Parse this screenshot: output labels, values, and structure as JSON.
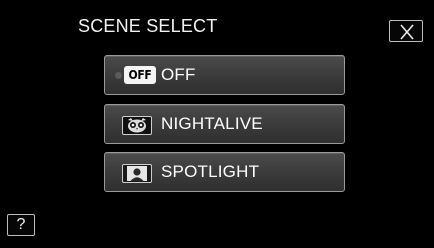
{
  "header": {
    "title": "SCENE SELECT"
  },
  "options": [
    {
      "badge": "OFF",
      "label": "OFF",
      "icon": "off-icon"
    },
    {
      "label": "NIGHTALIVE",
      "icon": "owl-icon"
    },
    {
      "label": "SPOTLIGHT",
      "icon": "spotlight-portrait-icon"
    }
  ],
  "help": {
    "label": "?"
  },
  "colors": {
    "background": "#000000",
    "button_fill": "#3f3f3f",
    "button_border": "#9a9a9a",
    "text": "#ffffff"
  }
}
